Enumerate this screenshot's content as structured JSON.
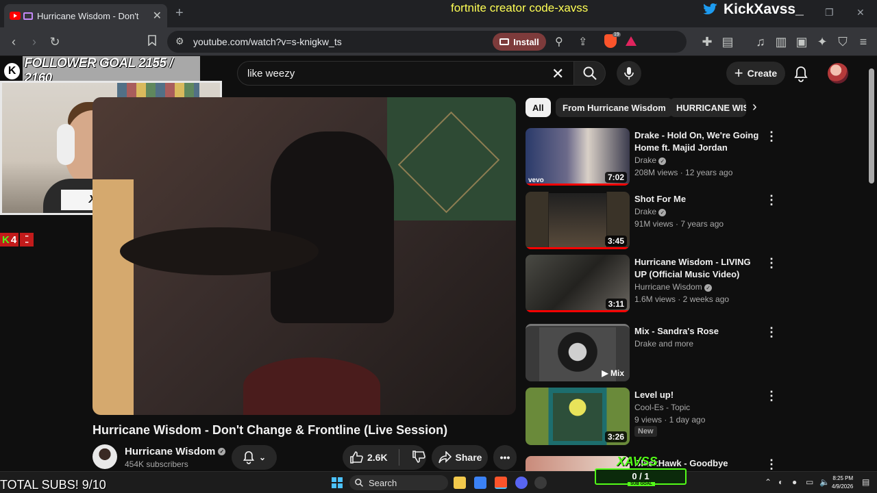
{
  "browser": {
    "tab_title": "Hurricane Wisdom - Don't Ch",
    "new_tab": "+",
    "url": "youtube.com/watch?v=s-knigkw_ts",
    "install_label": "Install",
    "brave_badge": "19"
  },
  "stream_overlay": {
    "creator_code": "fortnite creator code-xavss",
    "kick_name": "KickXavss_",
    "follower_goal": "FOLLOWER GOAL 2155 / 2160",
    "webcam_plate": "XAVSS",
    "kick_count": "4",
    "total_subs": "TOTAL SUBS! 9/10",
    "sub_goal": "0 / 1",
    "sub_goal_label": "SUB GOAL",
    "green_name": "XAVSS"
  },
  "youtube": {
    "search_query": "like weezy",
    "create_label": "Create",
    "video_title": "Hurricane Wisdom - Don't Change & Frontline (Live Session)",
    "channel_name": "Hurricane Wisdom",
    "subscribers": "454K subscribers",
    "likes": "2.6K",
    "share_label": "Share",
    "chips": [
      "All",
      "From Hurricane Wisdom",
      "HURRICANE WIS"
    ],
    "recommendations": [
      {
        "title": "Drake - Hold On, We're Going Home ft. Majid Jordan",
        "channel": "Drake",
        "verified": true,
        "meta": "208M views · 12 years ago",
        "duration": "7:02",
        "watched": 1.0
      },
      {
        "title": "Shot For Me",
        "channel": "Drake",
        "verified": true,
        "meta": "91M views · 7 years ago",
        "duration": "3:45",
        "watched": 1.0
      },
      {
        "title": "Hurricane Wisdom - LIVING UP (Official Music Video)",
        "channel": "Hurricane Wisdom",
        "verified": true,
        "meta": "1.6M views · 2 weeks ago",
        "duration": "3:11",
        "watched": 1.0
      },
      {
        "title": "Mix - Sandra's Rose",
        "channel": "Drake and more",
        "verified": false,
        "meta": "",
        "duration": "Mix",
        "watched": 0
      },
      {
        "title": "Level up!",
        "channel": "Cool-Es - Topic",
        "verified": false,
        "meta": "9 views · 1 day ago",
        "duration": "3:26",
        "watched": 0,
        "badge": "New"
      },
      {
        "title": "BlackHawk - Goodbye",
        "channel": "",
        "verified": false,
        "meta": "",
        "duration": "",
        "watched": 0
      }
    ]
  },
  "taskbar": {
    "search_label": "Search",
    "time": "8:25 PM",
    "date": "4/9/2026"
  },
  "colors": {
    "youtube_bg": "#0f0f0f",
    "accent_red": "#ff0000",
    "kick_green": "#53fc18",
    "chip_active": "#f1f1f1"
  }
}
